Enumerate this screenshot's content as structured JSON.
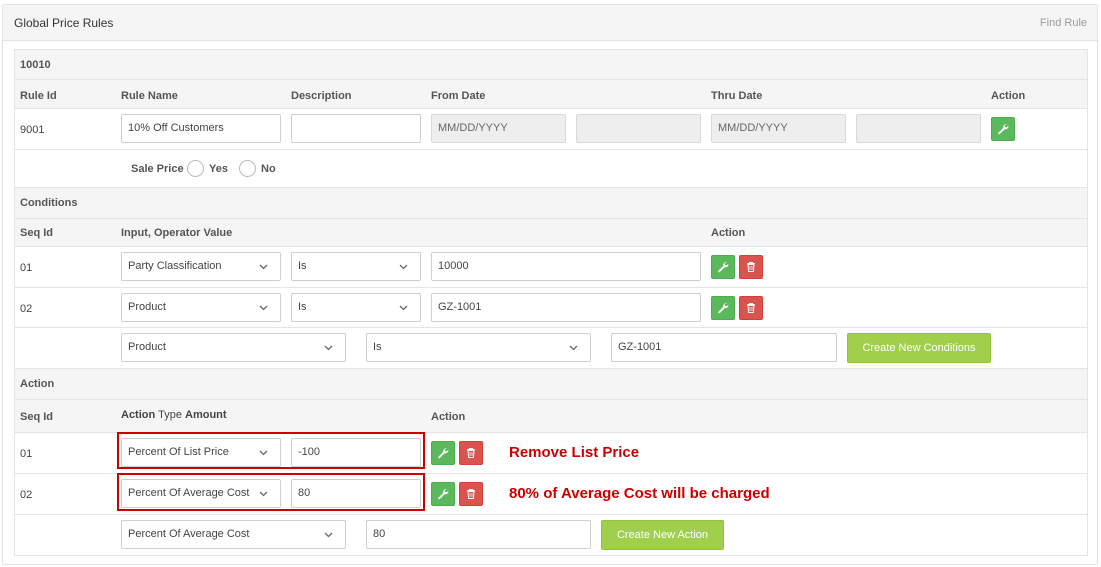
{
  "header": {
    "title": "Global Price Rules",
    "find_link": "Find Rule"
  },
  "rule_section": {
    "id_label": "10010",
    "columns": {
      "rule_id": "Rule Id",
      "rule_name": "Rule Name",
      "description": "Description",
      "from_date": "From Date",
      "thru_date": "Thru Date",
      "action": "Action"
    },
    "rule_id": "9001",
    "rule_name_value": "10% Off Customers",
    "description_value": "",
    "from_date_placeholder": "MM/DD/YYYY",
    "thru_date_placeholder": "MM/DD/YYYY",
    "sale_price": {
      "label": "Sale Price",
      "yes": "Yes",
      "no": "No"
    }
  },
  "conditions": {
    "title": "Conditions",
    "columns": {
      "seq_id": "Seq Id",
      "input_operator_value": "Input, Operator Value",
      "action": "Action"
    },
    "rows": [
      {
        "seq": "01",
        "input": "Party Classification",
        "operator": "Is",
        "value": "10000"
      },
      {
        "seq": "02",
        "input": "Product",
        "operator": "Is",
        "value": "GZ-1001"
      }
    ],
    "new_row": {
      "input": "Product",
      "operator": "Is",
      "value": "GZ-1001",
      "button": "Create New Conditions"
    }
  },
  "actions": {
    "title": "Action",
    "columns": {
      "seq_id": "Seq Id",
      "action_type_amount_a": "Action",
      "action_type_amount_b": "Type",
      "action_type_amount_c": "Amount",
      "action": "Action"
    },
    "rows": [
      {
        "seq": "01",
        "type": "Percent Of List Price",
        "amount": "-100",
        "annotation": "Remove List Price"
      },
      {
        "seq": "02",
        "type": "Percent Of Average Cost",
        "amount": "80",
        "annotation": "80% of Average Cost will be charged"
      }
    ],
    "new_row": {
      "type": "Percent Of Average Cost",
      "amount": "80",
      "button": "Create New Action"
    }
  },
  "colors": {
    "green": "#5cb85c",
    "red": "#d9534f",
    "create_button": "#a0cf4c",
    "annotation": "#cc0000"
  }
}
